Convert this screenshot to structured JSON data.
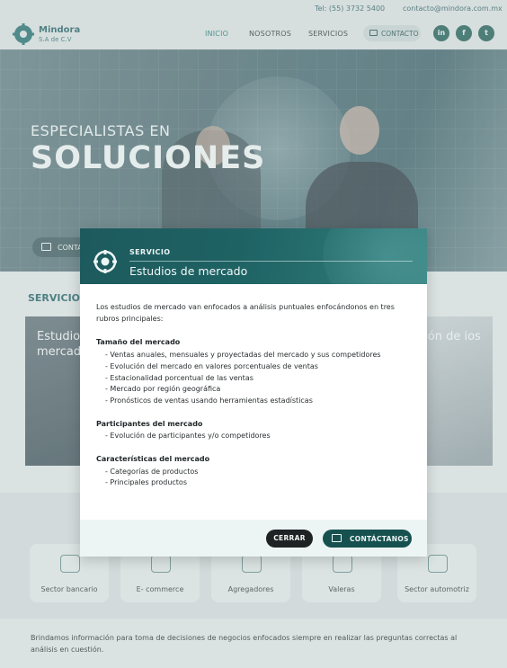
{
  "topbar": {
    "tel": "Tel: (55) 3732 5400",
    "email": "contacto@mindora.com.mx"
  },
  "brand": {
    "name": "Mindora",
    "sub": "S.A de C.V"
  },
  "nav": {
    "items": [
      "INICIO",
      "NOSOTROS",
      "SERVICIOS"
    ],
    "active": "INICIO",
    "contact_label": "CONTACTO",
    "social": [
      "in",
      "f",
      "t"
    ]
  },
  "hero": {
    "small": "ESPECIALISTAS EN",
    "big": "SOLUCIONES",
    "button": "CONTACTO"
  },
  "services": {
    "title": "SERVICIOS",
    "card_left": "Estudio de mercado",
    "card_right": "ción de ios"
  },
  "tiles": [
    "Sector bancario",
    "E- commerce",
    "Agregadores",
    "Valeras",
    "Sector automotriz"
  ],
  "footer_text": "Brindamos información para toma de decisiones de negocios enfocados siempre en realizar las preguntas correctas al análisis en cuestión.",
  "modal": {
    "kicker": "SERVICIO",
    "title": "Estudios de mercado",
    "intro": "Los estudios de mercado van enfocados a análisis puntuales enfocándonos en tres rubros principales:",
    "sections": [
      {
        "heading": "Tamaño del mercado",
        "items": [
          "- Ventas anuales, mensuales y proyectadas del mercado y sus competidores",
          "- Evolución del mercado en valores porcentuales de ventas",
          "- Estacionalidad porcentual de las ventas",
          "- Mercado por región geográfica",
          "- Pronósticos de ventas usando herramientas estadísticas"
        ]
      },
      {
        "heading": "Participantes del mercado",
        "items": [
          "- Evolución de participantes y/o competidores"
        ]
      },
      {
        "heading": "Características del mercado",
        "items": [
          "- Categorías de productos",
          "- Principales productos"
        ]
      }
    ],
    "close_label": "CERRAR",
    "contact_label": "CONTÁCTANOS"
  }
}
